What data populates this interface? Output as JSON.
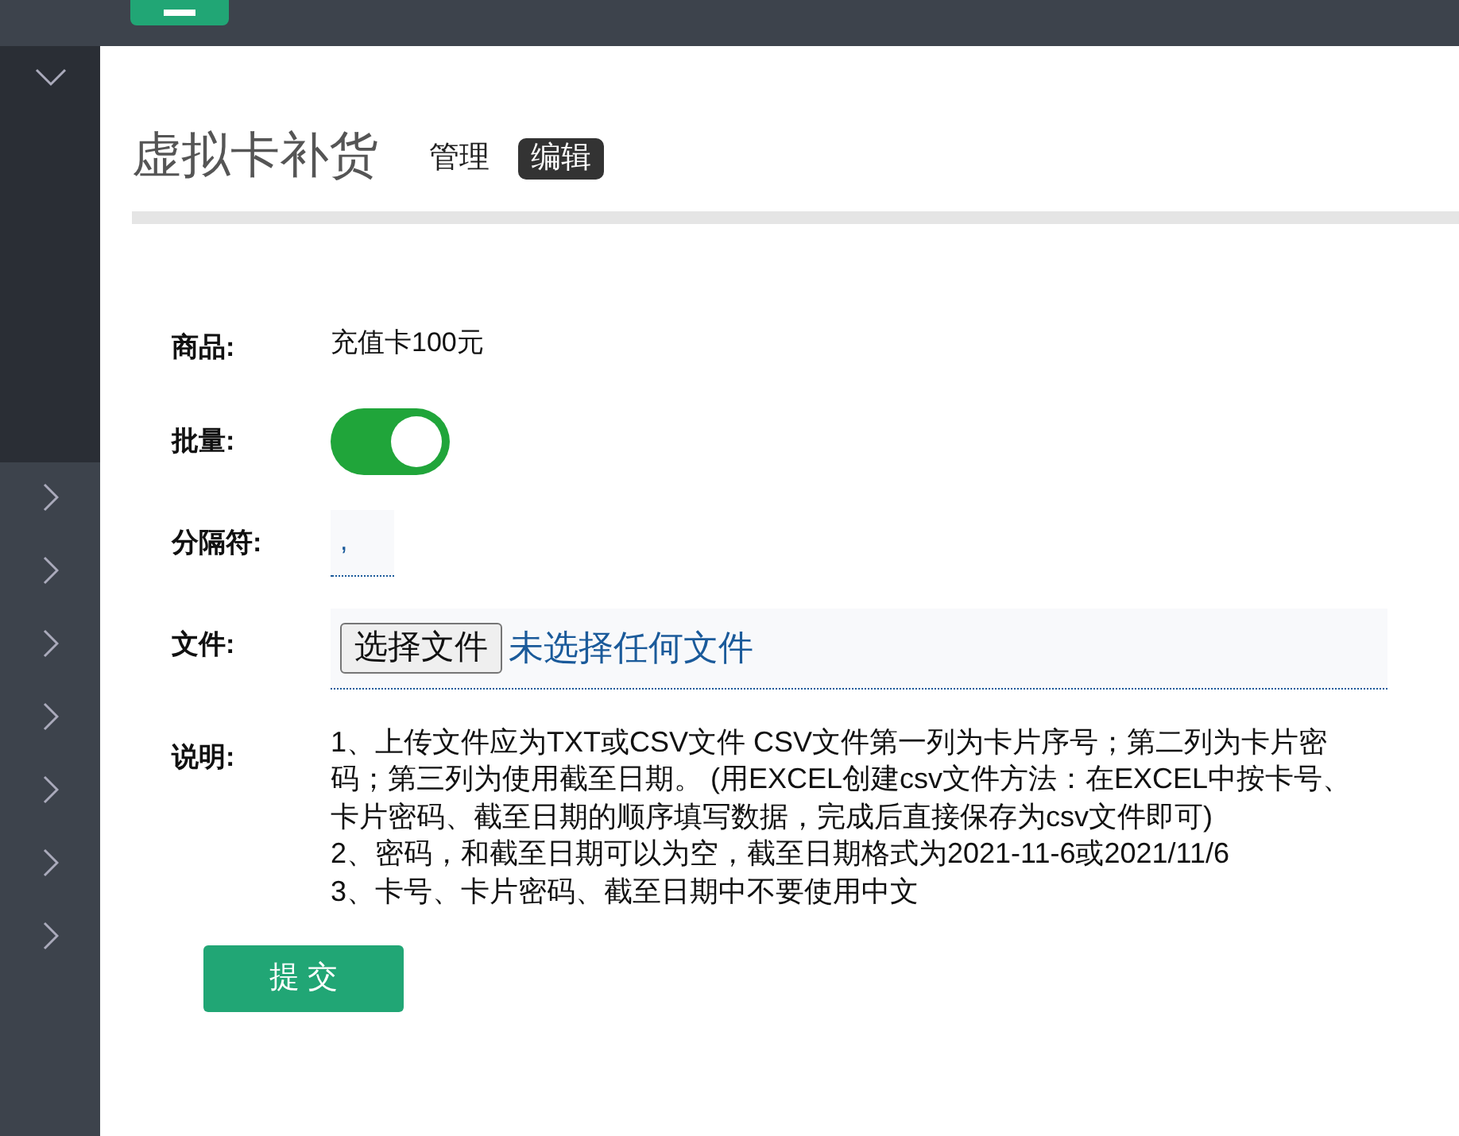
{
  "sidebar": {
    "top_expanded": true,
    "items": [
      {
        "expanded": false
      },
      {
        "expanded": false
      },
      {
        "expanded": false
      },
      {
        "expanded": false
      },
      {
        "expanded": false
      },
      {
        "expanded": false
      },
      {
        "expanded": false
      }
    ]
  },
  "page": {
    "title": "虚拟卡补货"
  },
  "tabs": [
    {
      "label": "管理",
      "selected": false
    },
    {
      "label": "编辑",
      "selected": true
    }
  ],
  "form": {
    "product": {
      "label": "商品:",
      "value": "充值卡100元"
    },
    "batch": {
      "label": "批量:",
      "on": true
    },
    "separator": {
      "label": "分隔符:",
      "value": ","
    },
    "file": {
      "label": "文件:",
      "button": "选择文件",
      "status": "未选择任何文件"
    },
    "notes": {
      "label": "说明:",
      "lines": [
        "1、上传文件应为TXT或CSV文件 CSV文件第一列为卡片序号；第二列为卡片密码；第三列为使用截至日期。 (用EXCEL创建csv文件方法：在EXCEL中按卡号、卡片密码、截至日期的顺序填写数据，完成后直接保存为csv文件即可)",
        "2、密码，和截至日期可以为空，截至日期格式为2021-11-6或2021/11/6",
        "3、卡号、卡片密码、截至日期中不要使用中文"
      ]
    }
  },
  "submit": "提 交"
}
